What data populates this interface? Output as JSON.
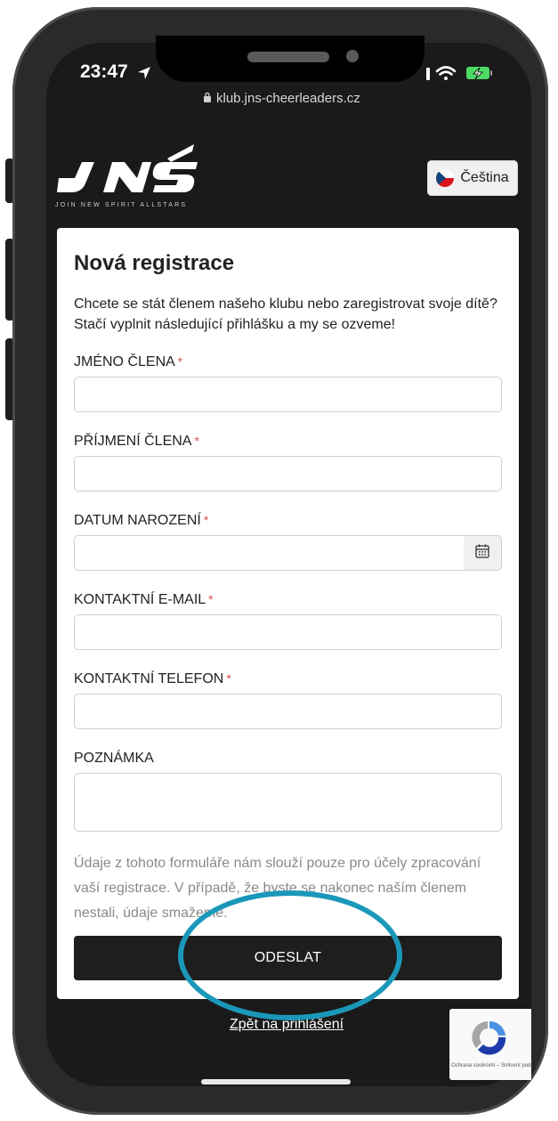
{
  "status_bar": {
    "time": "23:47"
  },
  "browser": {
    "url": "klub.jns-cheerleaders.cz"
  },
  "header": {
    "logo_text": "JNS",
    "logo_tagline": "JOIN NEW SPIRIT ALLSTARS",
    "language_label": "Čeština"
  },
  "form": {
    "title": "Nová registrace",
    "intro": "Chcete se stát členem našeho klubu nebo zaregistrovat svoje dítě? Stačí vyplnit následující přihlášku a my se ozveme!",
    "required_mark": "*",
    "fields": [
      {
        "label": "JMÉNO ČLENA"
      },
      {
        "label": "PŘÍJMENÍ ČLENA"
      },
      {
        "label": "DATUM NAROZENÍ"
      },
      {
        "label": "KONTAKTNÍ E-MAIL"
      },
      {
        "label": "KONTAKTNÍ TELEFON"
      },
      {
        "label": "POZNÁMKA"
      }
    ],
    "disclaimer": "Údaje z tohoto formuláře nám slouží pouze pro účely zpracování vaší registrace. V případě, že byste se nakonec naším členem nestali, údaje smažeme.",
    "submit_label": "ODESLAT"
  },
  "footer": {
    "back_link": "Zpět na přihlášení",
    "recaptcha_text": "Ochrana soukromí – Smluvní podmínky"
  },
  "colors": {
    "annotation": "#1b98b9",
    "required": "#d9534f",
    "page_bg": "#1a1a1a"
  }
}
